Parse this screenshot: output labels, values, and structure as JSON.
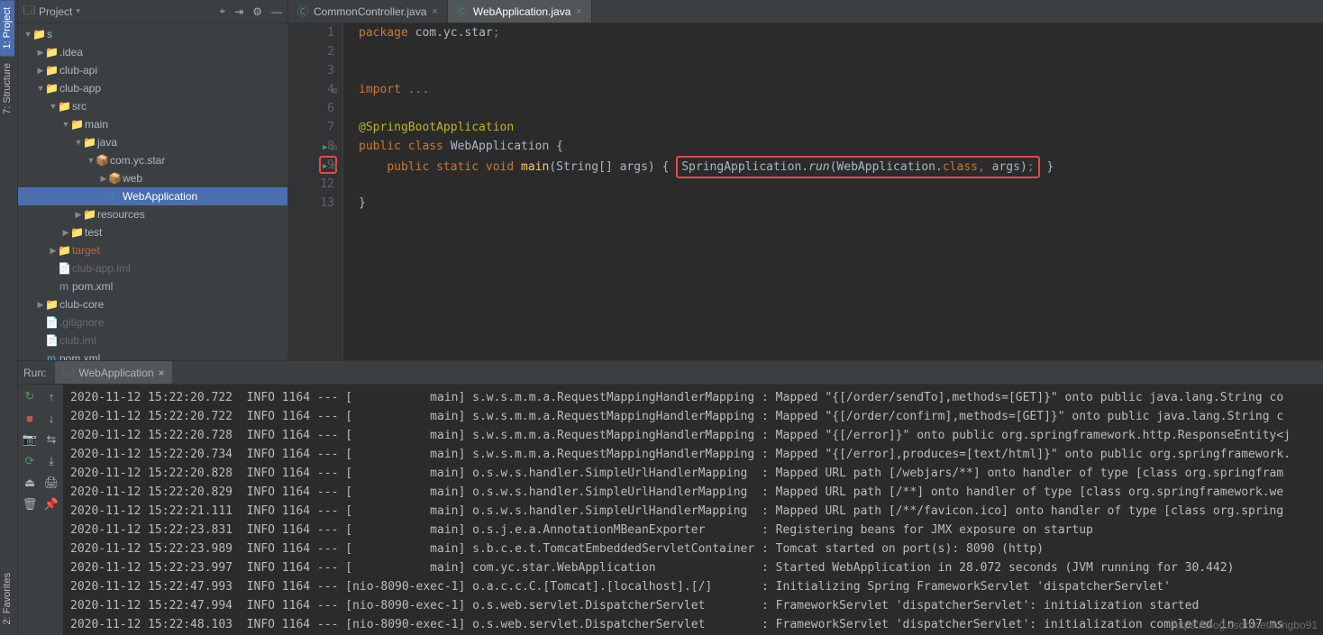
{
  "leftRail": {
    "project": "1: Project",
    "structure": "7: Structure",
    "favorites": "2: Favorites"
  },
  "projectPanel": {
    "title": "Project",
    "tree": [
      {
        "indent": 0,
        "arrow": "▼",
        "icon": "📁",
        "iconCls": "folder-blue",
        "label": "s"
      },
      {
        "indent": 1,
        "arrow": "▶",
        "icon": "📁",
        "iconCls": "folder-icon",
        "label": ".idea"
      },
      {
        "indent": 1,
        "arrow": "▶",
        "icon": "📁",
        "iconCls": "folder-blue",
        "label": "club-api"
      },
      {
        "indent": 1,
        "arrow": "▼",
        "icon": "📁",
        "iconCls": "folder-blue",
        "label": "club-app"
      },
      {
        "indent": 2,
        "arrow": "▼",
        "icon": "📁",
        "iconCls": "folder-blue",
        "label": "src"
      },
      {
        "indent": 3,
        "arrow": "▼",
        "icon": "📁",
        "iconCls": "folder-blue",
        "label": "main"
      },
      {
        "indent": 4,
        "arrow": "▼",
        "icon": "📁",
        "iconCls": "folder-blue",
        "label": "java"
      },
      {
        "indent": 5,
        "arrow": "▼",
        "icon": "📦",
        "iconCls": "pkg-icon",
        "label": "com.yc.star"
      },
      {
        "indent": 6,
        "arrow": "▶",
        "icon": "📦",
        "iconCls": "pkg-icon",
        "label": "web"
      },
      {
        "indent": 6,
        "arrow": "",
        "icon": "Ⓒ",
        "iconCls": "file-j",
        "label": "WebApplication",
        "selected": true
      },
      {
        "indent": 4,
        "arrow": "▶",
        "icon": "📁",
        "iconCls": "folder-icon",
        "label": "resources"
      },
      {
        "indent": 3,
        "arrow": "▶",
        "icon": "📁",
        "iconCls": "folder-icon",
        "label": "test"
      },
      {
        "indent": 2,
        "arrow": "▶",
        "icon": "📁",
        "iconCls": "target-dir",
        "label": "target"
      },
      {
        "indent": 2,
        "arrow": "",
        "icon": "📄",
        "iconCls": "file-x",
        "label": "club-app.iml"
      },
      {
        "indent": 2,
        "arrow": "",
        "icon": "m",
        "iconCls": "file-m",
        "label": "pom.xml"
      },
      {
        "indent": 1,
        "arrow": "▶",
        "icon": "📁",
        "iconCls": "folder-blue",
        "label": "club-core"
      },
      {
        "indent": 1,
        "arrow": "",
        "icon": "📄",
        "iconCls": "file-x",
        "label": ".gitignore"
      },
      {
        "indent": 1,
        "arrow": "",
        "icon": "📄",
        "iconCls": "file-x",
        "label": "club.iml"
      },
      {
        "indent": 1,
        "arrow": "",
        "icon": "m",
        "iconCls": "file-m",
        "label": "pom.xml"
      }
    ]
  },
  "tabs": [
    {
      "icon": "Ⓒ",
      "label": "CommonController.java",
      "active": false
    },
    {
      "icon": "Ⓒ",
      "label": "WebApplication.java",
      "active": true
    }
  ],
  "code": {
    "lines": [
      {
        "num": "1",
        "html": "<span class='kw'>package</span> com.yc.star<span class='cm'>;</span>"
      },
      {
        "num": "2",
        "html": ""
      },
      {
        "num": "3",
        "html": ""
      },
      {
        "num": "4",
        "html": "<span class='kw'>import</span> <span class='cm'>...</span>",
        "fold": "⊞"
      },
      {
        "num": "6",
        "html": ""
      },
      {
        "num": "7",
        "html": "<span class='ann'>@SpringBootApplication</span>"
      },
      {
        "num": "8",
        "html": "<span class='kw'>public class</span> WebApplication {",
        "run": "▶",
        "fold": "⊟"
      },
      {
        "num": "9",
        "html": "    <span class='kw'>public static void</span> <span class='fn'>main</span>(String[] args) { <span class='highlight-box'>SpringApplication.<span class='it'>run</span>(WebApplication.<span class='kw'>class</span><span class='cm'>,</span> args)<span class='cm'>;</span></span> }",
        "run": "▶",
        "runHighlight": true,
        "fold": "⊟"
      },
      {
        "num": "12",
        "html": ""
      },
      {
        "num": "13",
        "html": "}"
      }
    ]
  },
  "run": {
    "label": "Run:",
    "tab": "WebApplication",
    "console": [
      "2020-11-12 15:22:20.722  INFO 1164 --- [           main] s.w.s.m.m.a.RequestMappingHandlerMapping : Mapped \"{[/order/sendTo],methods=[GET]}\" onto public java.lang.String co",
      "2020-11-12 15:22:20.722  INFO 1164 --- [           main] s.w.s.m.m.a.RequestMappingHandlerMapping : Mapped \"{[/order/confirm],methods=[GET]}\" onto public java.lang.String c",
      "2020-11-12 15:22:20.728  INFO 1164 --- [           main] s.w.s.m.m.a.RequestMappingHandlerMapping : Mapped \"{[/error]}\" onto public org.springframework.http.ResponseEntity<j",
      "2020-11-12 15:22:20.734  INFO 1164 --- [           main] s.w.s.m.m.a.RequestMappingHandlerMapping : Mapped \"{[/error],produces=[text/html]}\" onto public org.springframework.",
      "2020-11-12 15:22:20.828  INFO 1164 --- [           main] o.s.w.s.handler.SimpleUrlHandlerMapping  : Mapped URL path [/webjars/**] onto handler of type [class org.springfram",
      "2020-11-12 15:22:20.829  INFO 1164 --- [           main] o.s.w.s.handler.SimpleUrlHandlerMapping  : Mapped URL path [/**] onto handler of type [class org.springframework.we",
      "2020-11-12 15:22:21.111  INFO 1164 --- [           main] o.s.w.s.handler.SimpleUrlHandlerMapping  : Mapped URL path [/**/favicon.ico] onto handler of type [class org.spring",
      "2020-11-12 15:22:23.831  INFO 1164 --- [           main] o.s.j.e.a.AnnotationMBeanExporter        : Registering beans for JMX exposure on startup",
      "2020-11-12 15:22:23.989  INFO 1164 --- [           main] s.b.c.e.t.TomcatEmbeddedServletContainer : Tomcat started on port(s): 8090 (http)",
      "2020-11-12 15:22:23.997  INFO 1164 --- [           main] com.yc.star.WebApplication               : Started WebApplication in 28.072 seconds (JVM running for 30.442)",
      "2020-11-12 15:22:47.993  INFO 1164 --- [nio-8090-exec-1] o.a.c.c.C.[Tomcat].[localhost].[/]       : Initializing Spring FrameworkServlet 'dispatcherServlet'",
      "2020-11-12 15:22:47.994  INFO 1164 --- [nio-8090-exec-1] o.s.web.servlet.DispatcherServlet        : FrameworkServlet 'dispatcherServlet': initialization started",
      "2020-11-12 15:22:48.103  INFO 1164 --- [nio-8090-exec-1] o.s.web.servlet.DispatcherServlet        : FrameworkServlet 'dispatcherServlet': initialization completed in 107 ms"
    ]
  },
  "watermark": "https://blog.csdn.net/rongbo91"
}
